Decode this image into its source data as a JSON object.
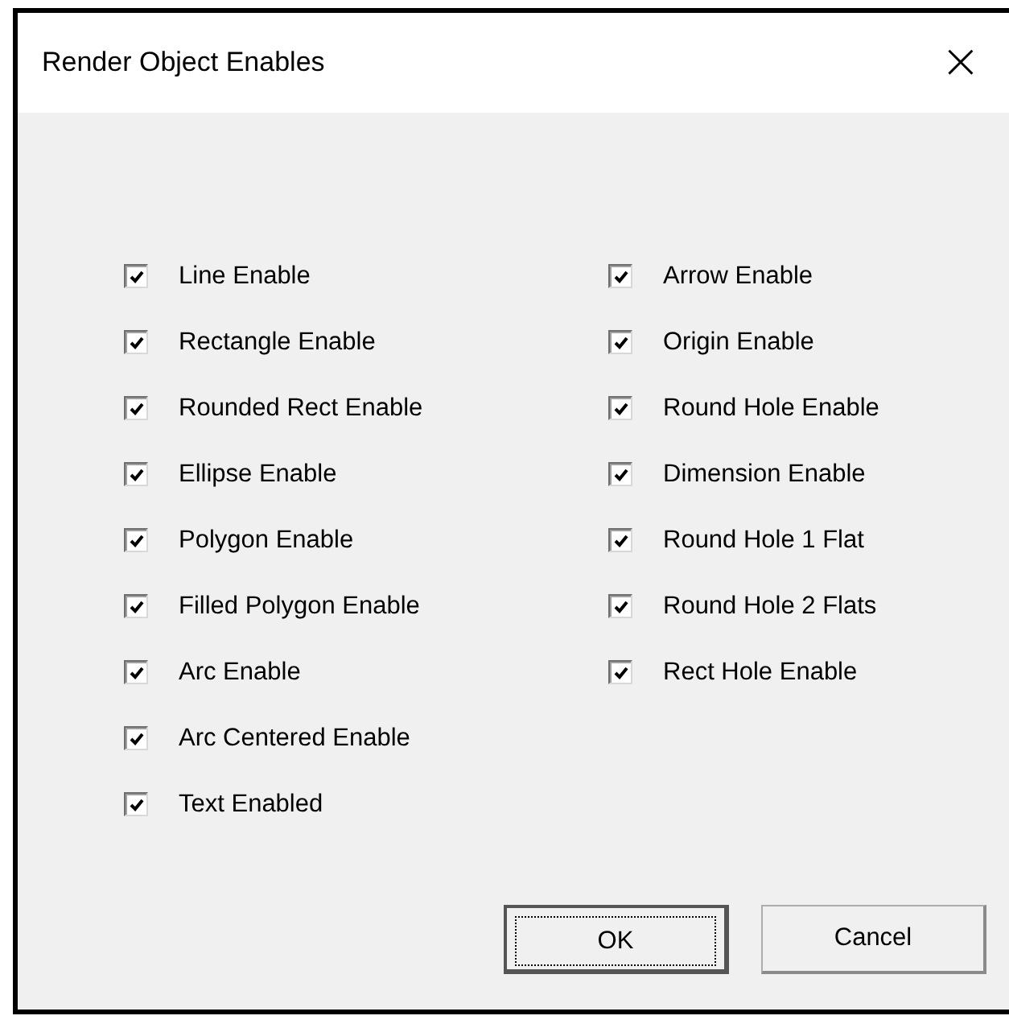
{
  "window": {
    "title": "Render Object Enables",
    "close": "×"
  },
  "columns": [
    [
      {
        "label": "Line Enable",
        "checked": true
      },
      {
        "label": "Rectangle Enable",
        "checked": true
      },
      {
        "label": "Rounded Rect Enable",
        "checked": true
      },
      {
        "label": "Ellipse Enable",
        "checked": true
      },
      {
        "label": "Polygon Enable",
        "checked": true
      },
      {
        "label": "Filled Polygon Enable",
        "checked": true
      },
      {
        "label": "Arc Enable",
        "checked": true
      },
      {
        "label": "Arc Centered Enable",
        "checked": true
      },
      {
        "label": "Text Enabled",
        "checked": true
      }
    ],
    [
      {
        "label": "Arrow Enable",
        "checked": true
      },
      {
        "label": "Origin Enable",
        "checked": true
      },
      {
        "label": "Round Hole Enable",
        "checked": true
      },
      {
        "label": "Dimension Enable",
        "checked": true
      },
      {
        "label": "Round Hole 1 Flat",
        "checked": true
      },
      {
        "label": "Round Hole 2 Flats",
        "checked": true
      },
      {
        "label": "Rect Hole Enable",
        "checked": true
      }
    ]
  ],
  "buttons": [
    {
      "label": "OK",
      "default": true
    },
    {
      "label": "Cancel",
      "default": false
    }
  ]
}
